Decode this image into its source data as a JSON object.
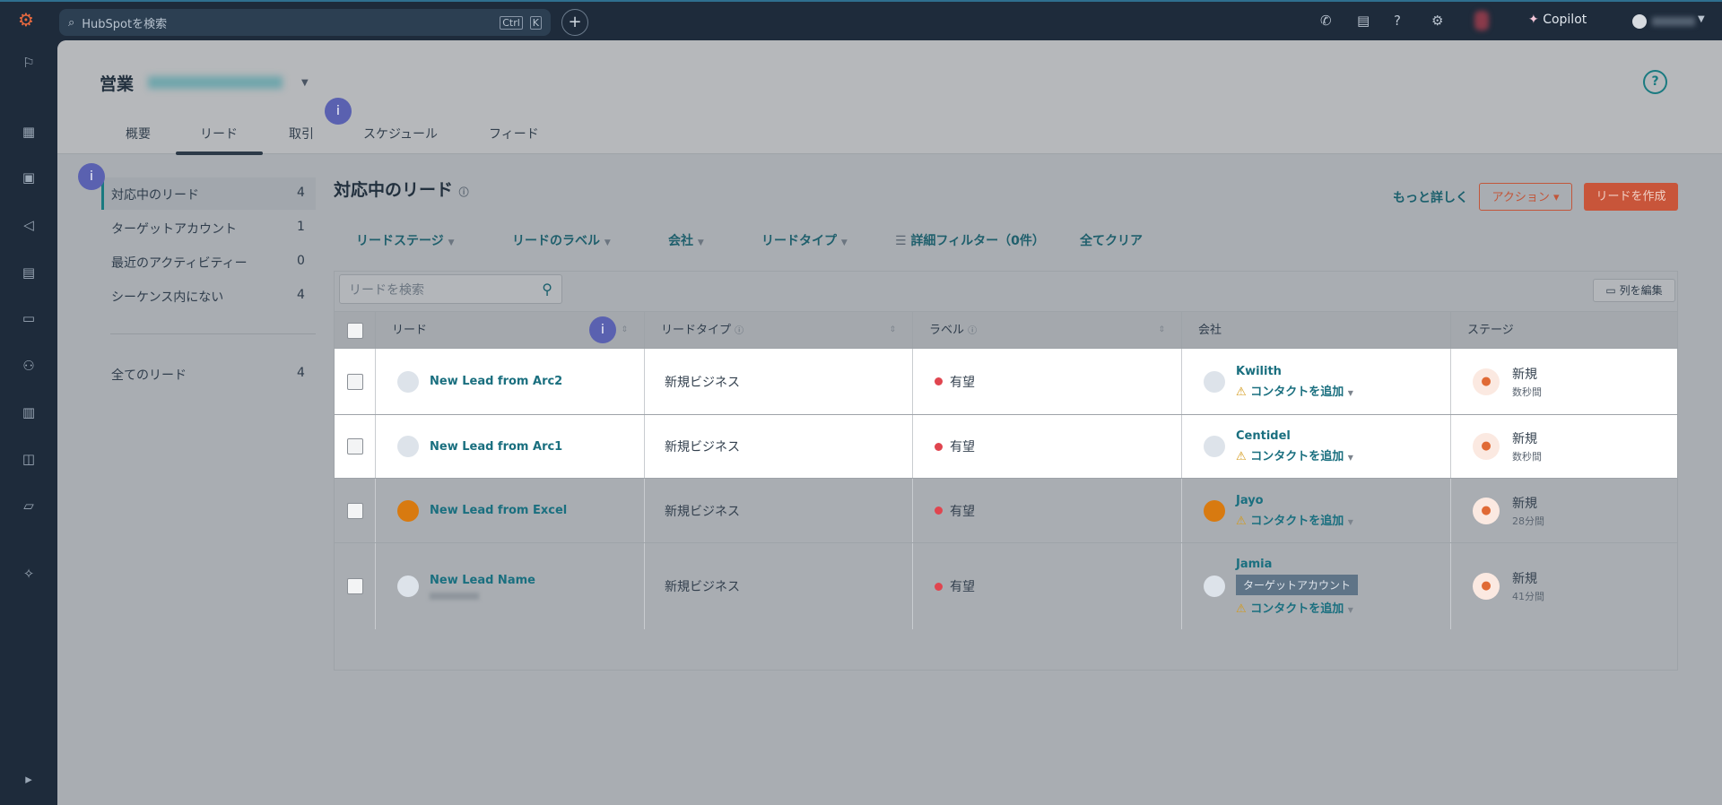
{
  "topbar": {
    "search_placeholder": "HubSpotを検索",
    "kbd_ctrl": "Ctrl",
    "kbd_k": "K",
    "copilot": "Copilot"
  },
  "header": {
    "title": "営業",
    "tabs": [
      "概要",
      "リード",
      "取引",
      "スケジュール",
      "フィード"
    ],
    "help": "?"
  },
  "info_badge": "i",
  "left_filters": [
    {
      "label": "対応中のリード",
      "count": "4"
    },
    {
      "label": "ターゲットアカウント",
      "count": "1"
    },
    {
      "label": "最近のアクティビティー",
      "count": "0"
    },
    {
      "label": "シーケンス内にない",
      "count": "4"
    }
  ],
  "all_leads": {
    "label": "全てのリード",
    "count": "4"
  },
  "page_title": "対応中のリード",
  "actions": {
    "learn_more": "もっと詳しく",
    "action": "アクション",
    "create": "リードを作成"
  },
  "filters": [
    "リードステージ",
    "リードのラベル",
    "会社",
    "リードタイプ",
    "詳細フィルター（0件）",
    "全てクリア"
  ],
  "table": {
    "search_placeholder": "リードを検索",
    "edit_columns": "列を編集",
    "columns": [
      "リード",
      "リードタイプ",
      "ラベル",
      "会社",
      "ステージ"
    ],
    "rows": [
      {
        "lead": "New Lead from Arc2",
        "type": "新規ビジネス",
        "label": "有望",
        "company": "Kwilith",
        "add_contact": "コンタクトを追加",
        "stage": "新規",
        "time": "数秒間"
      },
      {
        "lead": "New Lead from Arc1",
        "type": "新規ビジネス",
        "label": "有望",
        "company": "Centidel",
        "add_contact": "コンタクトを追加",
        "stage": "新規",
        "time": "数秒間"
      },
      {
        "lead": "New Lead from Excel",
        "type": "新規ビジネス",
        "label": "有望",
        "company": "Jayo",
        "add_contact": "コンタクトを追加",
        "stage": "新規",
        "time": "28分間"
      },
      {
        "lead": "New Lead Name",
        "type": "新規ビジネス",
        "label": "有望",
        "company": "Jamia",
        "tag": "ターゲットアカウント",
        "add_contact": "コンタクトを追加",
        "stage": "新規",
        "time": "41分間"
      }
    ]
  }
}
